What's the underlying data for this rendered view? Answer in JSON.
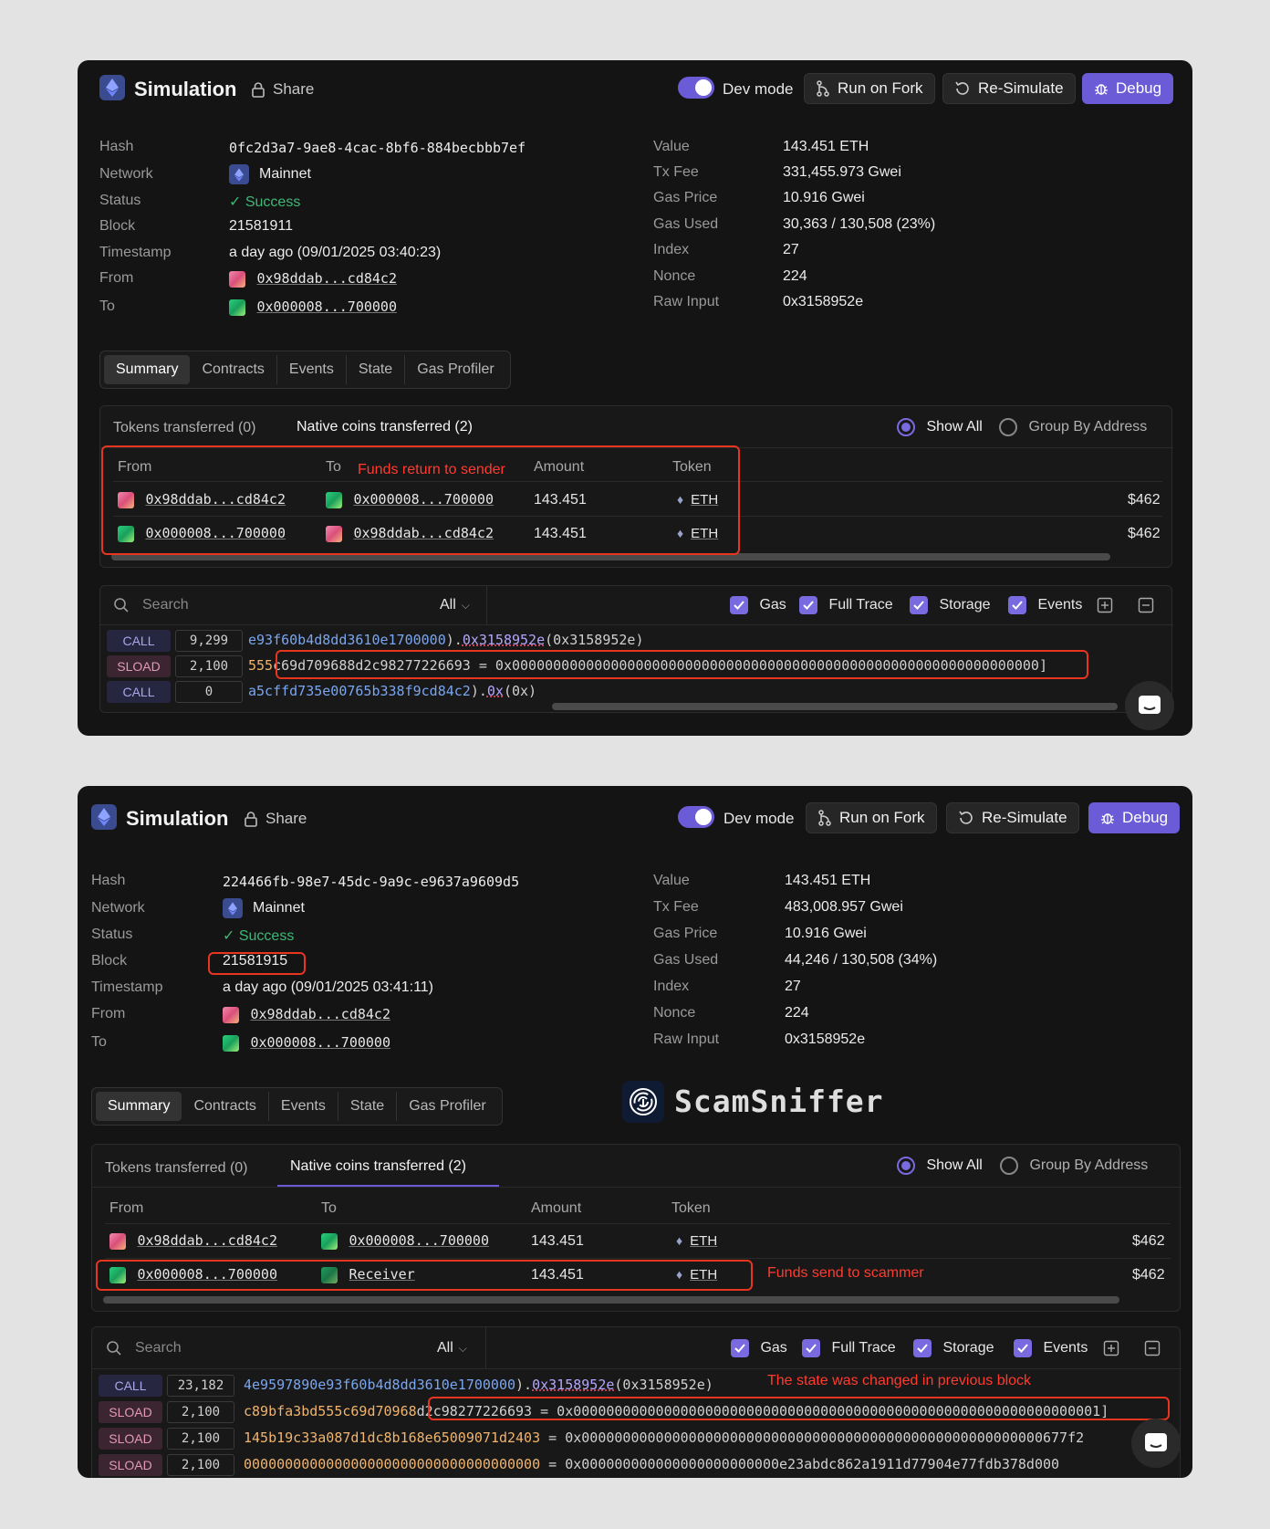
{
  "common": {
    "title": "Simulation",
    "share": "Share",
    "dev_mode": "Dev mode",
    "run_on_fork": "Run on Fork",
    "re_simulate": "Re-Simulate",
    "debug": "Debug",
    "labels": {
      "hash": "Hash",
      "network": "Network",
      "status": "Status",
      "block": "Block",
      "timestamp": "Timestamp",
      "from": "From",
      "to": "To",
      "value": "Value",
      "tx_fee": "Tx Fee",
      "gas_price": "Gas Price",
      "gas_used": "Gas Used",
      "index": "Index",
      "nonce": "Nonce",
      "raw_input": "Raw Input"
    },
    "tabs": [
      "Summary",
      "Contracts",
      "Events",
      "State",
      "Gas Profiler"
    ],
    "tokens_transferred": "Tokens transferred (0)",
    "native_coins": "Native coins transferred (2)",
    "show_all": "Show All",
    "group_by_address": "Group By Address",
    "table_headers": {
      "from": "From",
      "to": "To",
      "amount": "Amount",
      "token": "Token"
    },
    "search_placeholder": "Search",
    "filter_all": "All",
    "checks": {
      "gas": "Gas",
      "full_trace": "Full Trace",
      "storage": "Storage",
      "events": "Events"
    },
    "colors": {
      "accent": "#6b5bd6",
      "success": "#3fb877",
      "annotation": "#e8351f"
    }
  },
  "sim1": {
    "hash": "0fc2d3a7-9ae8-4cac-8bf6-884becbbb7ef",
    "network": "Mainnet",
    "status": "Success",
    "block": "21581911",
    "timestamp": "a day ago (09/01/2025 03:40:23)",
    "from": "0x98ddab...cd84c2",
    "to": "0x000008...700000",
    "value": "143.451 ETH",
    "tx_fee": "331,455.973 Gwei",
    "gas_price": "10.916 Gwei",
    "gas_used": "30,363 / 130,508 (23%)",
    "index": "27",
    "nonce": "224",
    "raw_input": "0x3158952e",
    "transfers": [
      {
        "from": "0x98ddab...cd84c2",
        "to": "0x000008...700000",
        "amount": "143.451",
        "token": "ETH",
        "usd": "$462"
      },
      {
        "from": "0x000008...700000",
        "to": "0x98ddab...cd84c2",
        "amount": "143.451",
        "token": "ETH",
        "usd": "$462"
      }
    ],
    "note_transfer": "Funds return to sender",
    "trace": [
      {
        "op": "CALL",
        "gas": "9,299",
        "a": "e93f60b4d8dd3610e1700000",
        "b": ").",
        "c": "0x3158952e",
        "d": "(0x3158952e)"
      },
      {
        "op": "SLOAD",
        "gas": "2,100",
        "a": "555",
        "b": "c69d709688d2c98277226693 = 0x0000000000000000000000000000000000000000000000000000000000000000]"
      },
      {
        "op": "CALL",
        "gas": "0",
        "a": "a5cffd735e00765b338f9cd84c2",
        "b": ").",
        "c": "0x",
        "d": "(0x)"
      }
    ]
  },
  "sim2": {
    "hash": "224466fb-98e7-45dc-9a9c-e9637a9609d5",
    "network": "Mainnet",
    "status": "Success",
    "block": "21581915",
    "timestamp": "a day ago (09/01/2025 03:41:11)",
    "from": "0x98ddab...cd84c2",
    "to": "0x000008...700000",
    "value": "143.451 ETH",
    "tx_fee": "483,008.957 Gwei",
    "gas_price": "10.916 Gwei",
    "gas_used": "44,246 / 130,508 (34%)",
    "index": "27",
    "nonce": "224",
    "raw_input": "0x3158952e",
    "watermark": "ScamSniffer",
    "transfers": [
      {
        "from": "0x98ddab...cd84c2",
        "to": "0x000008...700000",
        "amount": "143.451",
        "token": "ETH",
        "usd": "$462"
      },
      {
        "from": "0x000008...700000",
        "to": "Receiver",
        "amount": "143.451",
        "token": "ETH",
        "usd": "$462"
      }
    ],
    "note_transfer": "Funds send to scammer",
    "note_state": "The state was changed in previous block",
    "trace": [
      {
        "op": "CALL",
        "gas": "23,182",
        "a": "4e9597890e93f60b4d8dd3610e1700000",
        "b": ").",
        "c": "0x3158952e",
        "d": "(0x3158952e)"
      },
      {
        "op": "SLOAD",
        "gas": "2,100",
        "a": "c89bfa3bd555c69d70968",
        "b": "d2c98277226693 = 0x0000000000000000000000000000000000000000000000000000000000000001]"
      },
      {
        "op": "SLOAD",
        "gas": "2,100",
        "a": "145b19c33a087d1dc8b168e65009071d2403",
        "b": " = 0x00000000000000000000000000000000000000000000000000000000677f2"
      },
      {
        "op": "SLOAD",
        "gas": "2,100",
        "a": "000000000000000000000000000000000000",
        "b": " = 0x000000000000000000000000e23abdc862a1911d77904e77fdb378d000"
      }
    ]
  }
}
